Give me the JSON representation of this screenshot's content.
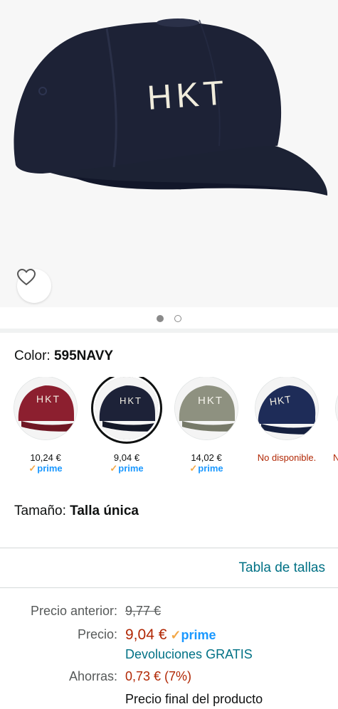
{
  "hero": {
    "cap_text": "HKT",
    "wishlist_icon": "heart-outline-icon",
    "carousel": {
      "total": 2,
      "active_index": 0
    }
  },
  "color": {
    "label": "Color:",
    "value": "595NAVY",
    "swatches": [
      {
        "name": "burgundy",
        "cap_color": "#8c1f2f",
        "price": "10,24 €",
        "prime": "prime",
        "available": true,
        "selected": false
      },
      {
        "name": "navy",
        "cap_color": "#1d2238",
        "price": "9,04 €",
        "prime": "prime",
        "available": true,
        "selected": true
      },
      {
        "name": "olive",
        "cap_color": "#8e9180",
        "price": "14,02 €",
        "prime": "prime",
        "available": true,
        "selected": false
      },
      {
        "name": "royal-navy",
        "cap_color": "#1e2c58",
        "unavailable_text": "No disponible.",
        "available": false,
        "selected": false
      },
      {
        "name": "partial",
        "unavailable_text": "N",
        "available": false,
        "selected": false
      }
    ]
  },
  "size": {
    "label": "Tamaño:",
    "value": "Talla única"
  },
  "size_chart_link": "Tabla de tallas",
  "pricing": {
    "previous_label": "Precio anterior:",
    "previous_value": "9,77 €",
    "price_label": "Precio:",
    "price_value": "9,04 €",
    "prime": "prime",
    "returns": "Devoluciones GRATIS",
    "savings_label": "Ahorras:",
    "savings_value": "0,73 € (7%)",
    "final_note": "Precio final del producto"
  },
  "colors": {
    "price_red": "#b12704",
    "link_teal": "#007185",
    "prime_blue": "#1a98ff",
    "check_orange": "#f3a847"
  }
}
